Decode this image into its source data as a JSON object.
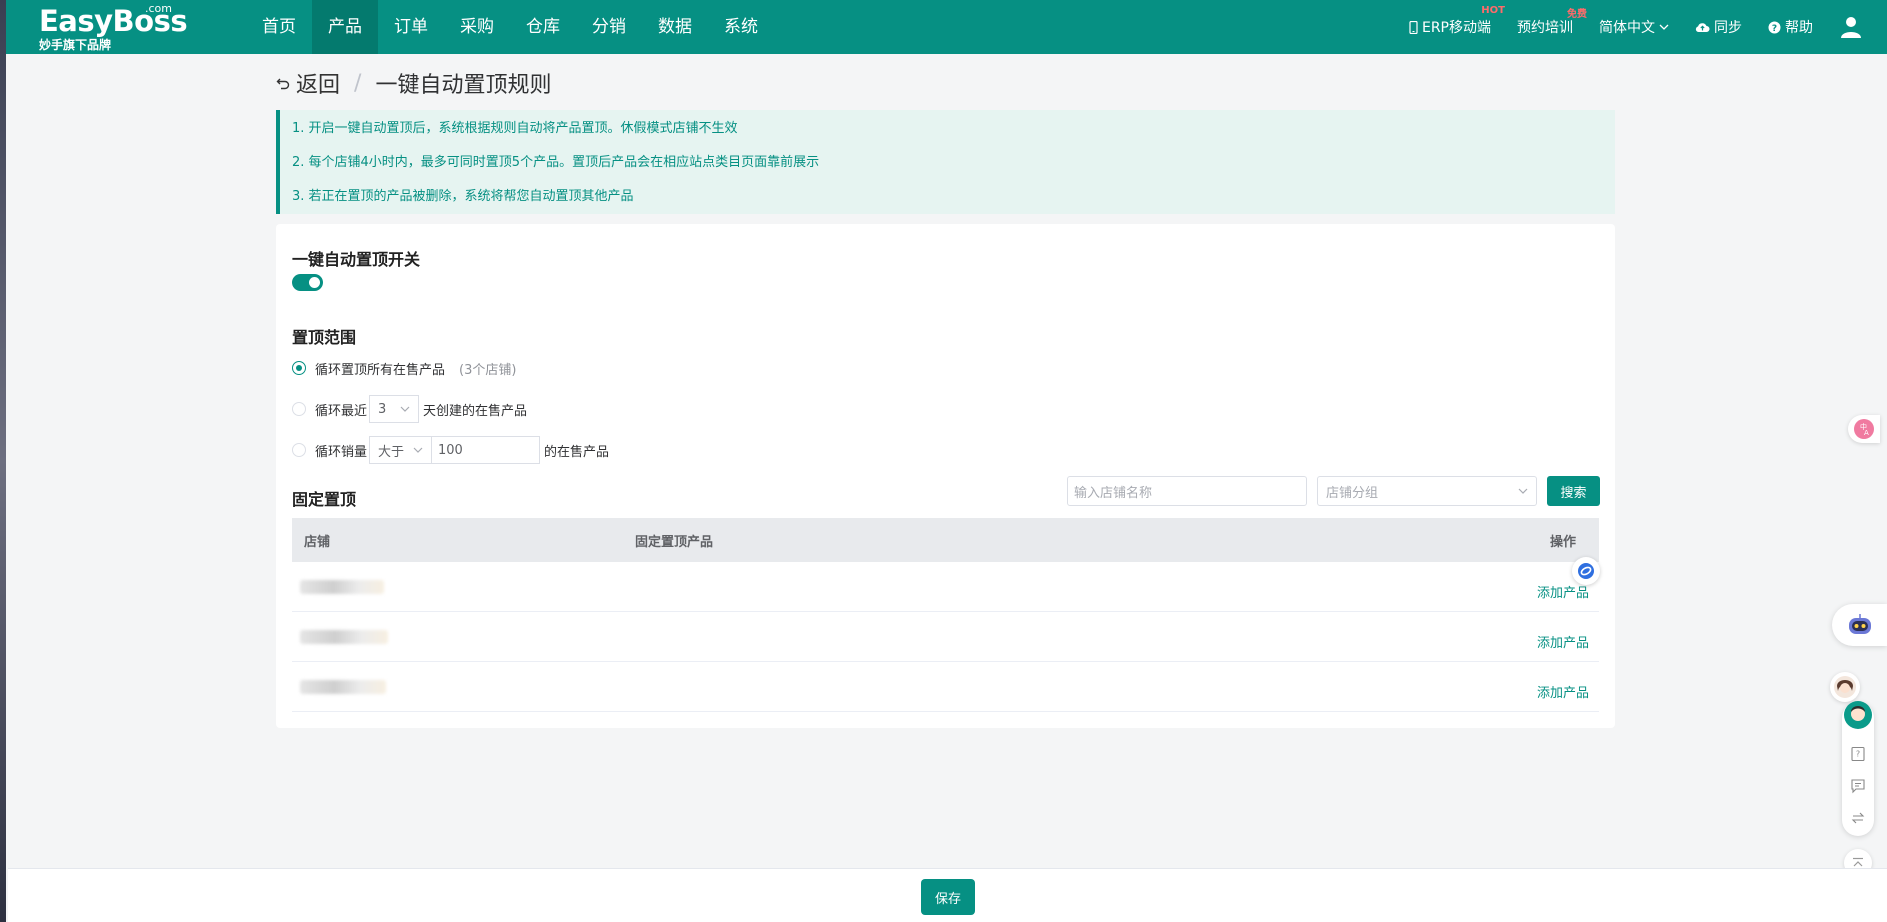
{
  "logo": {
    "main": "EasyBoss",
    "com": ".com",
    "sub": "妙手旗下品牌"
  },
  "nav": [
    {
      "label": "首页",
      "active": false
    },
    {
      "label": "产品",
      "active": true
    },
    {
      "label": "订单",
      "active": false
    },
    {
      "label": "采购",
      "active": false
    },
    {
      "label": "仓库",
      "active": false
    },
    {
      "label": "分销",
      "active": false
    },
    {
      "label": "数据",
      "active": false
    },
    {
      "label": "系统",
      "active": false
    }
  ],
  "topright": {
    "erp_mobile": "ERP移动端",
    "erp_badge": "HOT",
    "training": "预约培训",
    "training_badge": "免费",
    "language": "简体中文",
    "sync": "同步",
    "help": "帮助"
  },
  "breadcrumb": {
    "back": "返回",
    "separator": "/",
    "title": "一键自动置顶规则"
  },
  "notice": [
    "1. 开启一键自动置顶后，系统根据规则自动将产品置顶。休假模式店铺不生效",
    "2. 每个店铺4小时内，最多可同时置顶5个产品。置顶后产品会在相应站点类目页面靠前展示",
    "3. 若正在置顶的产品被删除，系统将帮您自动置顶其他产品"
  ],
  "switch_section": {
    "title": "一键自动置顶开关",
    "enabled": true
  },
  "scope_section": {
    "title": "置顶范围",
    "option_all": {
      "label": "循环置顶所有在售产品",
      "hint": "(3个店铺)",
      "checked": true
    },
    "option_recent": {
      "prefix": "循环最近",
      "days": "3",
      "suffix": "天创建的在售产品",
      "checked": false
    },
    "option_sales": {
      "prefix": "循环销量",
      "operator": "大于",
      "value": "100",
      "suffix": "的在售产品",
      "checked": false
    }
  },
  "fixed_section": {
    "title": "固定置顶",
    "search_placeholder": "输入店铺名称",
    "group_placeholder": "店铺分组",
    "search_button": "搜索",
    "columns": {
      "shop": "店铺",
      "product": "固定置顶产品",
      "action": "操作"
    },
    "rows": [
      {
        "action": "添加产品"
      },
      {
        "action": "添加产品"
      },
      {
        "action": "添加产品"
      }
    ]
  },
  "footer": {
    "save": "保存"
  },
  "colors": {
    "primary": "#069083",
    "notice_bg": "#e6f4f1"
  }
}
